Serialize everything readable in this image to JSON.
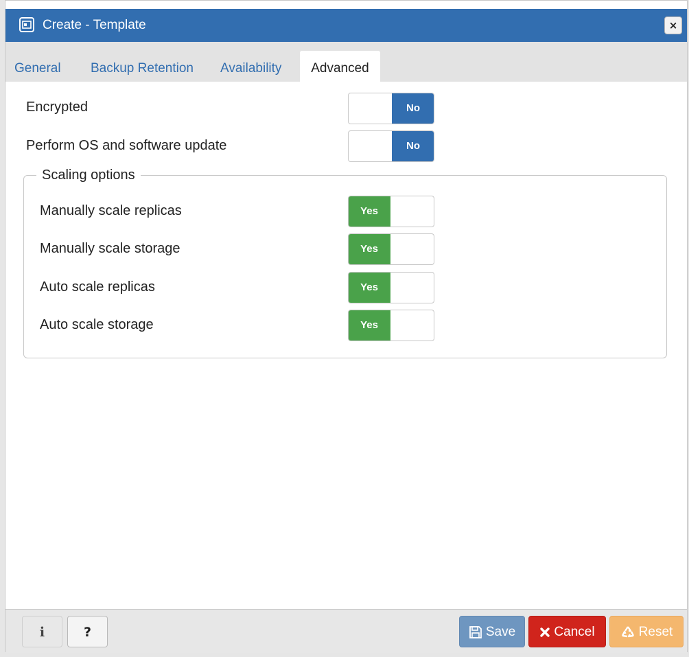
{
  "dialog": {
    "title": "Create - Template",
    "close_label": "×"
  },
  "tabs": [
    {
      "label": "General",
      "active": false
    },
    {
      "label": "Backup Retention",
      "active": false
    },
    {
      "label": "Availability",
      "active": false
    },
    {
      "label": "Advanced",
      "active": true
    }
  ],
  "fields": {
    "encrypted": {
      "label": "Encrypted",
      "value": "No"
    },
    "os_update": {
      "label": "Perform OS and software update",
      "value": "No"
    }
  },
  "scaling": {
    "legend": "Scaling options",
    "rows": [
      {
        "label": "Manually scale replicas",
        "value": "Yes"
      },
      {
        "label": "Manually scale storage",
        "value": "Yes"
      },
      {
        "label": "Auto scale replicas",
        "value": "Yes"
      },
      {
        "label": "Auto scale storage",
        "value": "Yes"
      }
    ]
  },
  "footer": {
    "info_label": "i",
    "help_label": "?",
    "save_label": "Save",
    "cancel_label": "Cancel",
    "reset_label": "Reset"
  },
  "colors": {
    "primary": "#326eb0",
    "yes": "#4aa24a",
    "cancel": "#d0241c",
    "reset": "#f4b76e",
    "save": "#6e96c0"
  },
  "icons": {
    "title": "dialog-window-icon",
    "save": "floppy-disk-icon",
    "cancel": "x-mark-icon",
    "reset": "recycle-icon"
  }
}
